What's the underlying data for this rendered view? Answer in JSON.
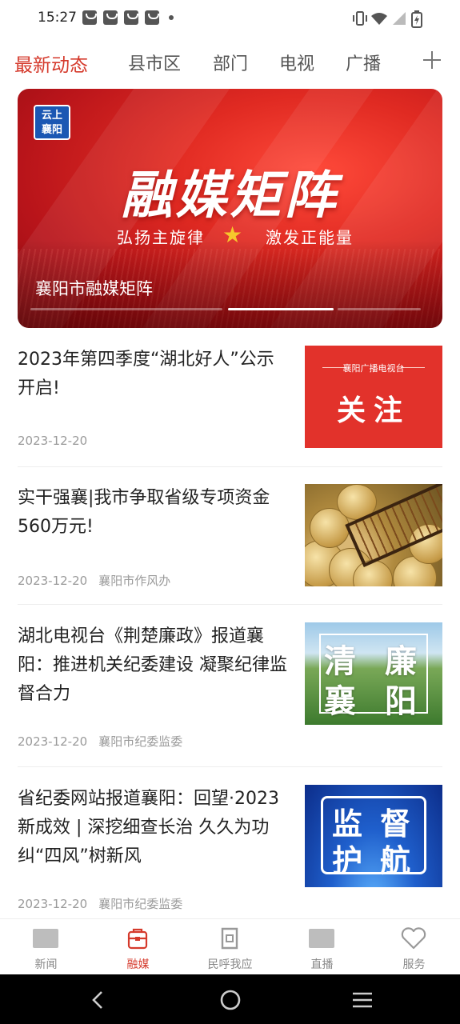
{
  "status_bar": {
    "time": "15:27",
    "notification_icons": [
      "app-notification-icon",
      "app-notification-icon",
      "app-notification-icon",
      "app-notification-icon",
      "more-dot-icon"
    ],
    "system_icons": [
      "vibrate-icon",
      "wifi-icon",
      "signal-icon",
      "battery-charging-icon"
    ]
  },
  "tabs": {
    "items": [
      {
        "label": "最新动态",
        "active": true
      },
      {
        "label": "县市区",
        "active": false
      },
      {
        "label": "部门",
        "active": false
      },
      {
        "label": "电视",
        "active": false
      },
      {
        "label": "广播",
        "active": false
      }
    ],
    "add_icon": "plus-icon",
    "accent_color": "#d53a2c"
  },
  "banner": {
    "logo_text": "云上\n襄阳",
    "headline": "融媒矩阵",
    "slogan_left": "弘扬主旋律",
    "slogan_right": "激发正能量",
    "caption": "襄阳市融媒矩阵",
    "slide_count": 3,
    "active_slide": 1
  },
  "articles": [
    {
      "title": "2023年第四季度“湖北好人”公示开启!",
      "date": "2023-12-20",
      "source": "",
      "thumb": {
        "top": "襄阳广播电视台",
        "big": "关注"
      }
    },
    {
      "title": "实干强襄|我市争取省级专项资金560万元!",
      "date": "2023-12-20",
      "source": "襄阳市作风办",
      "thumb": {}
    },
    {
      "title": "湖北电视台《荆楚廉政》报道襄阳：推进机关纪委建设 凝聚纪律监督合力",
      "date": "2023-12-20",
      "source": "襄阳市纪委监委",
      "thumb": {
        "c1": "清",
        "c2": "廉",
        "c3": "襄",
        "c4": "阳"
      }
    },
    {
      "title": "省纪委网站报道襄阳：回望·2023新成效 | 深挖细查长治 久久为功纠“四风”树新风",
      "date": "2023-12-20",
      "source": "襄阳市纪委监委",
      "thumb": {
        "c1": "监",
        "c2": "督",
        "c3": "护",
        "c4": "航"
      }
    }
  ],
  "bottom_nav": {
    "items": [
      {
        "label": "新闻",
        "icon": "news-icon",
        "active": false
      },
      {
        "label": "融媒",
        "icon": "media-bag-icon",
        "active": true
      },
      {
        "label": "民呼我应",
        "icon": "ask-icon",
        "active": false
      },
      {
        "label": "直播",
        "icon": "live-tv-icon",
        "active": false
      },
      {
        "label": "服务",
        "icon": "heart-icon",
        "active": false
      }
    ]
  },
  "system_nav": {
    "icons": [
      "back-icon",
      "home-icon",
      "recents-icon"
    ]
  }
}
